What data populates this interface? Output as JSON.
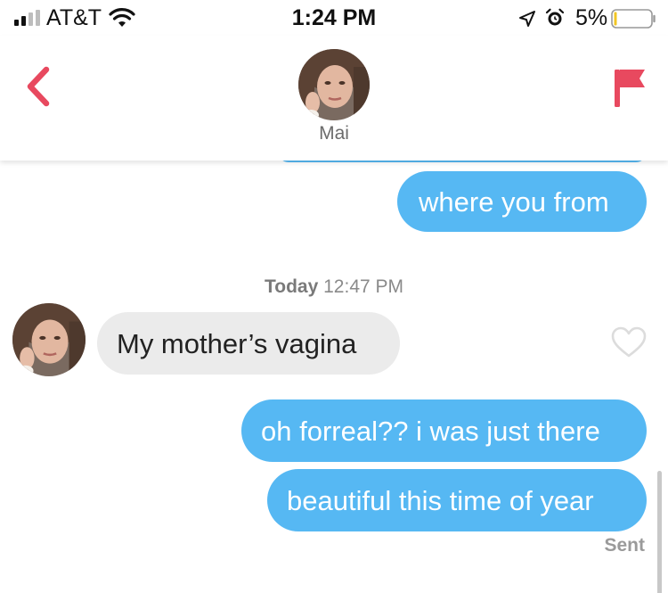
{
  "status_bar": {
    "carrier": "AT&T",
    "time": "1:24 PM",
    "battery_percent": "5%",
    "battery_level": 0.05,
    "icons": [
      "signal-icon",
      "wifi-icon",
      "location-arrow-icon",
      "alarm-icon",
      "battery-icon"
    ]
  },
  "header": {
    "contact_name": "Mai",
    "back_icon": "chevron-left-icon",
    "report_icon": "flag-icon",
    "accent_color": "#e8495f"
  },
  "chat": {
    "messages": [
      {
        "direction": "outgoing",
        "text": "where you from"
      },
      {
        "direction": "incoming",
        "text": "My mother’s vagina"
      },
      {
        "direction": "outgoing",
        "text": "oh forreal?? i was just there"
      },
      {
        "direction": "outgoing",
        "text": "beautiful this time of year"
      }
    ],
    "timestamp_day": "Today",
    "timestamp_time": "12:47 PM",
    "sent_label": "Sent",
    "like_icon": "heart-outline-icon",
    "outgoing_color": "#56b8f3",
    "incoming_color": "#ebebeb"
  }
}
